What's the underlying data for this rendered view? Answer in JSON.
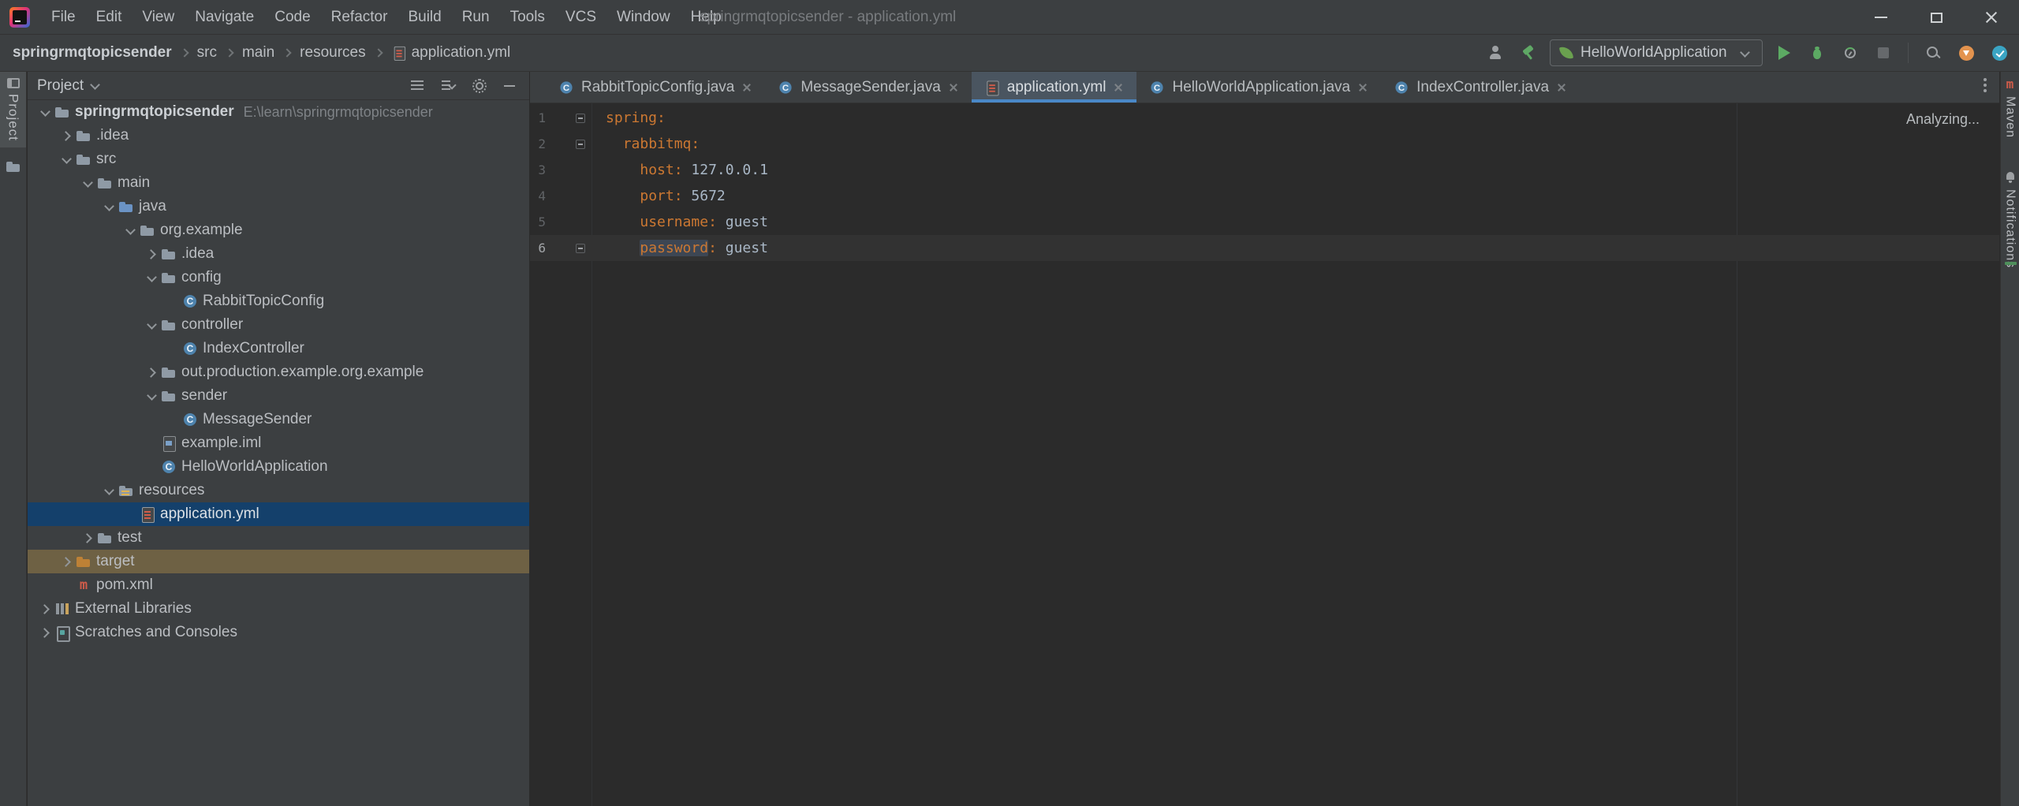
{
  "window": {
    "title": "springrmqtopicsender - application.yml",
    "menu": [
      "File",
      "Edit",
      "View",
      "Navigate",
      "Code",
      "Refactor",
      "Build",
      "Run",
      "Tools",
      "VCS",
      "Window",
      "Help"
    ]
  },
  "toolbar": {
    "breadcrumbs": [
      "springrmqtopicsender",
      "src",
      "main",
      "resources",
      "application.yml"
    ],
    "run_config": "HelloWorldApplication"
  },
  "stripes": {
    "project": "Project",
    "maven": "Maven",
    "notifications": "Notifications"
  },
  "panel": {
    "header": "Project",
    "tree": [
      {
        "label": "springrmqtopicsender",
        "path": "E:\\learn\\springrmqtopicsender",
        "icon": "project-folder",
        "expanded": true
      },
      {
        "label": ".idea",
        "icon": "folder",
        "expanded": false
      },
      {
        "label": "src",
        "icon": "folder",
        "expanded": true
      },
      {
        "label": "main",
        "icon": "folder",
        "expanded": true
      },
      {
        "label": "java",
        "icon": "source-folder",
        "expanded": true
      },
      {
        "label": "org.example",
        "icon": "package",
        "expanded": true
      },
      {
        "label": ".idea",
        "icon": "folder",
        "expanded": false
      },
      {
        "label": "config",
        "icon": "package",
        "expanded": true
      },
      {
        "label": "RabbitTopicConfig",
        "icon": "class"
      },
      {
        "label": "controller",
        "icon": "package",
        "expanded": true
      },
      {
        "label": "IndexController",
        "icon": "class"
      },
      {
        "label": "out.production.example.org.example",
        "icon": "folder",
        "expanded": false
      },
      {
        "label": "sender",
        "icon": "package",
        "expanded": true
      },
      {
        "label": "MessageSender",
        "icon": "class"
      },
      {
        "label": "example.iml",
        "icon": "iml-file"
      },
      {
        "label": "HelloWorldApplication",
        "icon": "class"
      },
      {
        "label": "resources",
        "icon": "resources-folder",
        "expanded": true
      },
      {
        "label": "application.yml",
        "icon": "yml-file",
        "selected": true
      },
      {
        "label": "test",
        "icon": "folder",
        "expanded": false
      },
      {
        "label": "target",
        "icon": "excluded-folder",
        "expanded": false,
        "highlighted": true
      },
      {
        "label": "pom.xml",
        "icon": "maven-file"
      },
      {
        "label": "External Libraries",
        "icon": "libraries",
        "expanded": false
      },
      {
        "label": "Scratches and Consoles",
        "icon": "scratches",
        "expanded": false
      }
    ]
  },
  "tabs": [
    {
      "label": "RabbitTopicConfig.java",
      "icon": "class",
      "active": false
    },
    {
      "label": "MessageSender.java",
      "icon": "class",
      "active": false
    },
    {
      "label": "application.yml",
      "icon": "yml-file",
      "active": true
    },
    {
      "label": "HelloWorldApplication.java",
      "icon": "class",
      "active": false
    },
    {
      "label": "IndexController.java",
      "icon": "class",
      "active": false
    }
  ],
  "editor": {
    "status": "Analyzing...",
    "language": "yaml",
    "lines": [
      {
        "num": "1",
        "indent": "",
        "key": "spring",
        "colon": ":",
        "value": ""
      },
      {
        "num": "2",
        "indent": "  ",
        "key": "rabbitmq",
        "colon": ":",
        "value": ""
      },
      {
        "num": "3",
        "indent": "    ",
        "key": "host",
        "colon": ":",
        "value": " 127.0.0.1"
      },
      {
        "num": "4",
        "indent": "    ",
        "key": "port",
        "colon": ":",
        "value": " 5672"
      },
      {
        "num": "5",
        "indent": "    ",
        "key": "username",
        "colon": ":",
        "value": " guest"
      },
      {
        "num": "6",
        "indent": "    ",
        "key": "password",
        "colon": ":",
        "value": " guest"
      }
    ]
  },
  "colors": {
    "bar_bg": "#3c3f41",
    "editor_bg": "#2b2b2b",
    "selection_blue": "#14406b",
    "target_highlight": "#6e6144",
    "tab_underline": "#4a88c7",
    "yaml_key": "#cc7832",
    "yaml_value": "#a9b7c6",
    "run_green": "#5caa63",
    "line_number": "#606366"
  }
}
